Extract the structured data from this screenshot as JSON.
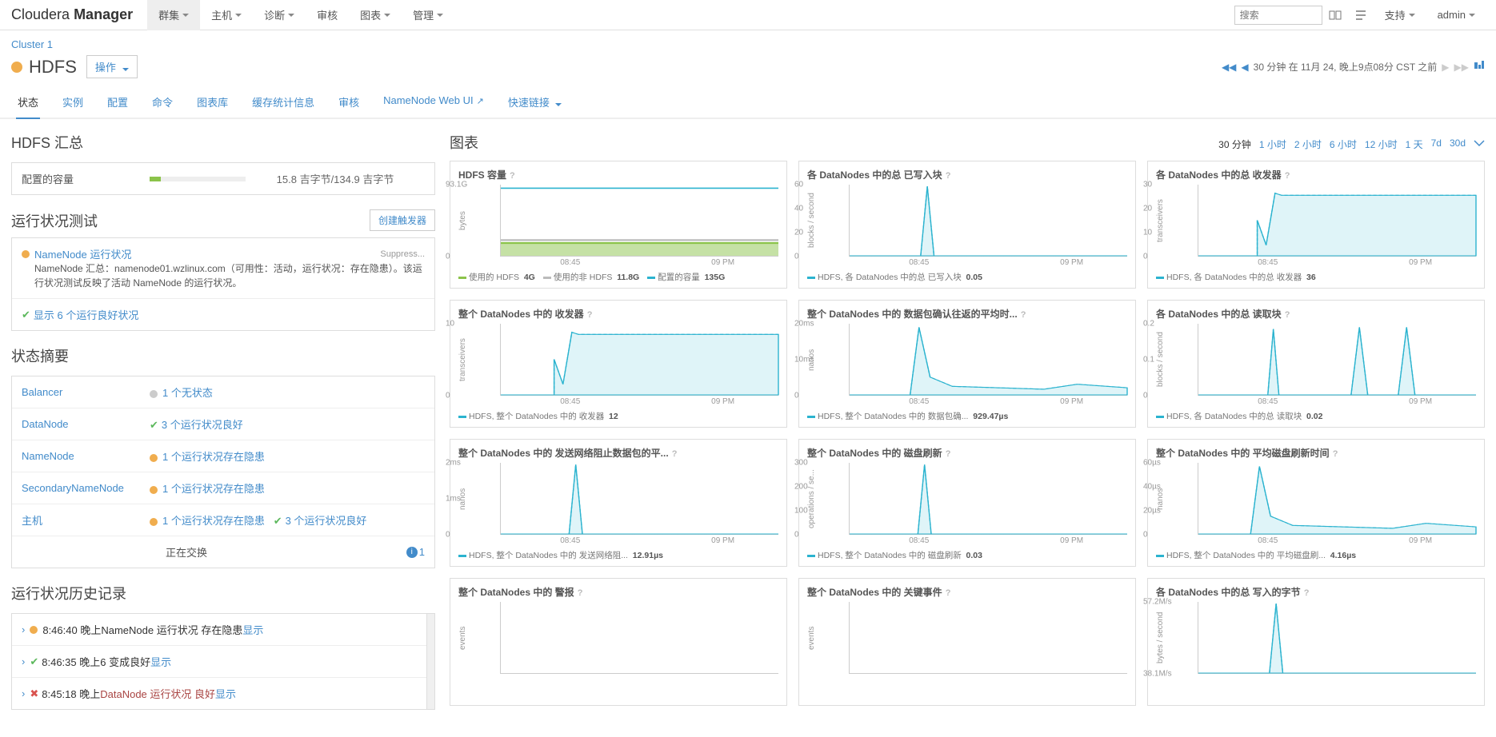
{
  "brand_a": "Cloudera",
  "brand_b": "Manager",
  "topnav": {
    "clusters": "群集",
    "hosts": "主机",
    "diagnostics": "诊断",
    "audits": "审核",
    "charts": "图表",
    "admin": "管理"
  },
  "search_placeholder": "搜索",
  "support": "支持",
  "user": "admin",
  "breadcrumb": "Cluster 1",
  "service": "HDFS",
  "action_btn": "操作",
  "timerange_text": "30 分钟 在 11月 24, 晚上9点08分 CST 之前",
  "tabs": {
    "status": "状态",
    "instances": "实例",
    "config": "配置",
    "commands": "命令",
    "library": "图表库",
    "cache": "缓存统计信息",
    "audit": "审核",
    "webui": "NameNode Web UI",
    "quick": "快速链接"
  },
  "summary_header": "HDFS 汇总",
  "capacity_label": "配置的容量",
  "capacity_text": "15.8 吉字节/134.9 吉字节",
  "capacity_pct": 11.7,
  "health_header": "运行状况测试",
  "create_trigger": "创建触发器",
  "nn_health_title": "NameNode 运行状况",
  "nn_health_desc": "NameNode 汇总：namenode01.wzlinux.com（可用性：活动，运行状况：存在隐患）。该运行状况测试反映了活动 NameNode 的运行状况。",
  "suppress": "Suppress...",
  "show_good": "显示 6 个运行良好状况",
  "status_summary_header": "状态摘要",
  "status_rows": [
    {
      "name": "Balancer",
      "text": "1 个无状态",
      "dot": "gray"
    },
    {
      "name": "DataNode",
      "text": "3 个运行状况良好",
      "dot": "green",
      "check": true
    },
    {
      "name": "NameNode",
      "text": "1 个运行状况存在隐患",
      "dot": "yellow"
    },
    {
      "name": "SecondaryNameNode",
      "text": "1 个运行状况存在隐患",
      "dot": "yellow"
    },
    {
      "name": "主机",
      "text": "1 个运行状况存在隐患",
      "dot": "yellow",
      "extra": "3 个运行状况良好"
    }
  ],
  "swapping": "正在交换",
  "history_header": "运行状况历史记录",
  "history": [
    {
      "time": "8:46:40 晚上",
      "dot": "yellow",
      "msg": "NameNode 运行状况 存在隐患",
      "show": "显示"
    },
    {
      "time": "8:46:35 晚上",
      "dot": "green",
      "check": true,
      "msg": "6 变成良好",
      "show": "显示"
    },
    {
      "time": "8:45:18 晚上",
      "dot": "red",
      "msg": "DataNode 运行状况 良好",
      "show": "显示",
      "red": true
    }
  ],
  "chart_header": "图表",
  "time_opts": [
    "30 分钟",
    "1 小时",
    "2 小时",
    "6 小时",
    "12 小时",
    "1 天",
    "7d",
    "30d"
  ],
  "chart_data": [
    {
      "title": "HDFS 容量",
      "ylabel": "bytes",
      "yticks": [
        "93.1G",
        "0"
      ],
      "xticks": [
        "08:45",
        "09 PM"
      ],
      "type": "area_flat",
      "top": 135,
      "fill": 15,
      "legends": [
        {
          "c": "#8bc34a",
          "t": "使用的 HDFS",
          "v": "4G"
        },
        {
          "c": "#bbb",
          "t": "使用的非 HDFS",
          "v": "11.8G"
        },
        {
          "c": "#2bb3cf",
          "t": "配置的容量",
          "v": "135G"
        }
      ]
    },
    {
      "title": "各 DataNodes 中的总 已写入块",
      "ylabel": "blocks / second",
      "yticks": [
        "60",
        "40",
        "20",
        "0"
      ],
      "xticks": [
        "08:45",
        "09 PM"
      ],
      "type": "spike",
      "spike_x": 0.28,
      "legends": [
        {
          "c": "#2bb3cf",
          "t": "HDFS, 各 DataNodes 中的总 已写入块",
          "v": "0.05"
        }
      ]
    },
    {
      "title": "各 DataNodes 中的总 收发器",
      "ylabel": "transceivers",
      "yticks": [
        "30",
        "20",
        "10",
        "0"
      ],
      "xticks": [
        "08:45",
        "09 PM"
      ],
      "type": "step_up",
      "step_x": 0.26,
      "legends": [
        {
          "c": "#2bb3cf",
          "t": "HDFS, 各 DataNodes 中的总 收发器",
          "v": "36"
        }
      ]
    },
    {
      "title": "整个 DataNodes 中的 收发器",
      "ylabel": "transceivers",
      "yticks": [
        "10",
        "0"
      ],
      "xticks": [
        "08:45",
        "09 PM"
      ],
      "type": "step_up",
      "step_x": 0.24,
      "legends": [
        {
          "c": "#2bb3cf",
          "t": "HDFS, 整个 DataNodes 中的 收发器",
          "v": "12"
        }
      ]
    },
    {
      "title": "整个 DataNodes 中的 数据包确认往返的平均时...",
      "ylabel": "nanos",
      "yticks": [
        "20ms",
        "10ms",
        "0"
      ],
      "xticks": [
        "08:45",
        "09 PM"
      ],
      "type": "decay",
      "peak_x": 0.25,
      "legends": [
        {
          "c": "#2bb3cf",
          "t": "HDFS, 整个 DataNodes 中的 数据包确...",
          "v": "929.47µs"
        }
      ]
    },
    {
      "title": "各 DataNodes 中的总 读取块",
      "ylabel": "blocks / second",
      "yticks": [
        "0.2",
        "0.1",
        "0"
      ],
      "xticks": [
        "08:45",
        "09 PM"
      ],
      "type": "pulses",
      "legends": [
        {
          "c": "#2bb3cf",
          "t": "HDFS, 各 DataNodes 中的总 读取块",
          "v": "0.02"
        }
      ]
    },
    {
      "title": "整个 DataNodes 中的 发送网络阻止数据包的平...",
      "ylabel": "nanos",
      "yticks": [
        "2ms",
        "1ms",
        "0"
      ],
      "xticks": [
        "08:45",
        "09 PM"
      ],
      "type": "spike",
      "spike_x": 0.27,
      "legends": [
        {
          "c": "#2bb3cf",
          "t": "HDFS, 整个 DataNodes 中的 发送网络阻...",
          "v": "12.91µs"
        }
      ]
    },
    {
      "title": "整个 DataNodes 中的 磁盘刷新",
      "ylabel": "operations / se...",
      "yticks": [
        "300",
        "200",
        "100",
        "0"
      ],
      "xticks": [
        "08:45",
        "09 PM"
      ],
      "type": "spike",
      "spike_x": 0.27,
      "legends": [
        {
          "c": "#2bb3cf",
          "t": "HDFS, 整个 DataNodes 中的 磁盘刷新",
          "v": "0.03"
        }
      ]
    },
    {
      "title": "整个 DataNodes 中的 平均磁盘刷新时间",
      "ylabel": "nanos",
      "yticks": [
        "60µs",
        "40µs",
        "20µs",
        "0"
      ],
      "xticks": [
        "08:45",
        "09 PM"
      ],
      "type": "decay",
      "peak_x": 0.22,
      "legends": [
        {
          "c": "#2bb3cf",
          "t": "HDFS, 整个 DataNodes 中的 平均磁盘刷...",
          "v": "4.16µs"
        }
      ]
    },
    {
      "title": "整个 DataNodes 中的 警报",
      "ylabel": "events",
      "yticks": [],
      "xticks": [],
      "type": "empty",
      "legends": []
    },
    {
      "title": "整个 DataNodes 中的 关键事件",
      "ylabel": "events",
      "yticks": [],
      "xticks": [],
      "type": "empty",
      "legends": []
    },
    {
      "title": "各 DataNodes 中的总 写入的字节",
      "ylabel": "bytes / second",
      "yticks": [
        "57.2M/s",
        "38.1M/s"
      ],
      "xticks": [],
      "type": "spike",
      "spike_x": 0.28,
      "legends": []
    }
  ]
}
